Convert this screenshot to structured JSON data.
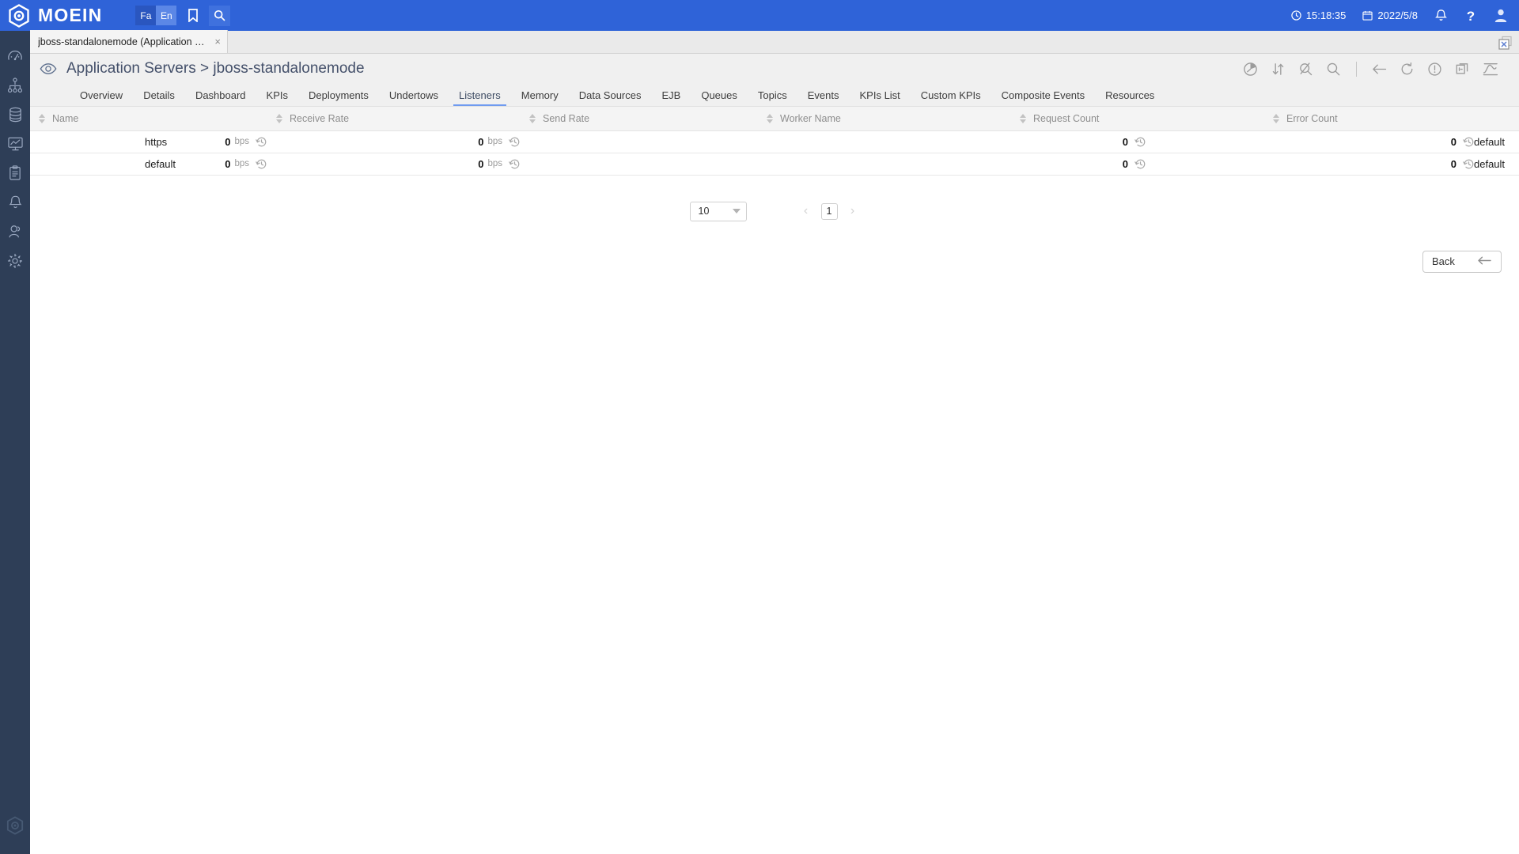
{
  "header": {
    "brand": "MOEIN",
    "logo_icon": "hexagon-eye-logo",
    "lang_fa": "Fa",
    "lang_en": "En",
    "bookmark_icon": "bookmark-icon",
    "search_icon": "search-icon",
    "time": "15:18:35",
    "date": "2022/5/8",
    "clock_icon": "clock-icon",
    "calendar_icon": "calendar-icon",
    "bell_icon": "bell-icon",
    "help_icon": "question-mark-icon",
    "user_icon": "user-avatar-icon",
    "accent_color": "#2f63d8"
  },
  "sidebar": {
    "background": "#2e3e57",
    "items": [
      {
        "icon": "gauge-icon",
        "name": "dashboard"
      },
      {
        "icon": "topology-icon",
        "name": "topology"
      },
      {
        "icon": "database-icon",
        "name": "database"
      },
      {
        "icon": "monitor-chart-icon",
        "name": "monitoring"
      },
      {
        "icon": "clipboard-icon",
        "name": "reports"
      },
      {
        "icon": "bell-icon",
        "name": "alerts"
      },
      {
        "icon": "user-icon",
        "name": "users"
      },
      {
        "icon": "gear-icon",
        "name": "settings"
      }
    ],
    "footer_icon": "moein-watermark-logo"
  },
  "tabstrip": {
    "tabs": [
      {
        "label": "jboss-standalonemode (Application S...",
        "close": "×",
        "active": true
      }
    ],
    "close_all_icon": "close-all-tabs-icon"
  },
  "breadcrumb": {
    "eye_icon": "eye-icon",
    "text": "Application Servers > jboss-standalonemode",
    "tools": [
      {
        "icon": "pie-clock-icon",
        "name": "time-range"
      },
      {
        "icon": "sort-arrows-icon",
        "name": "sort"
      },
      {
        "icon": "no-search-icon",
        "name": "clear-filter"
      },
      {
        "icon": "search-icon",
        "name": "search"
      },
      {
        "icon": "separator",
        "name": "divider"
      },
      {
        "icon": "arrow-left-icon",
        "name": "back"
      },
      {
        "icon": "refresh-icon",
        "name": "refresh"
      },
      {
        "icon": "alert-circle-icon",
        "name": "alerts"
      },
      {
        "icon": "duplicate-icon",
        "name": "duplicate"
      },
      {
        "icon": "chart-line-icon",
        "name": "chart"
      }
    ]
  },
  "navtabs": [
    {
      "label": "Overview",
      "active": false
    },
    {
      "label": "Details",
      "active": false
    },
    {
      "label": "Dashboard",
      "active": false
    },
    {
      "label": "KPIs",
      "active": false
    },
    {
      "label": "Deployments",
      "active": false
    },
    {
      "label": "Undertows",
      "active": false
    },
    {
      "label": "Listeners",
      "active": true
    },
    {
      "label": "Memory",
      "active": false
    },
    {
      "label": "Data Sources",
      "active": false
    },
    {
      "label": "EJB",
      "active": false
    },
    {
      "label": "Queues",
      "active": false
    },
    {
      "label": "Topics",
      "active": false
    },
    {
      "label": "Events",
      "active": false
    },
    {
      "label": "KPIs List",
      "active": false
    },
    {
      "label": "Custom KPIs",
      "active": false
    },
    {
      "label": "Composite Events",
      "active": false
    },
    {
      "label": "Resources",
      "active": false
    }
  ],
  "table": {
    "columns": [
      {
        "label": "Name",
        "sortable": true
      },
      {
        "label": "Receive Rate",
        "sortable": true
      },
      {
        "label": "Send Rate",
        "sortable": true
      },
      {
        "label": "Worker Name",
        "sortable": true
      },
      {
        "label": "Request Count",
        "sortable": true
      },
      {
        "label": "Error Count",
        "sortable": true
      }
    ],
    "history_icon": "history-clock-icon",
    "rows": [
      {
        "name": "https",
        "receive_rate": "0",
        "receive_unit": "bps",
        "send_rate": "0",
        "send_unit": "bps",
        "worker_name": "default",
        "request_count": "0",
        "error_count": "0"
      },
      {
        "name": "default",
        "receive_rate": "0",
        "receive_unit": "bps",
        "send_rate": "0",
        "send_unit": "bps",
        "worker_name": "default",
        "request_count": "0",
        "error_count": "0"
      }
    ]
  },
  "pagination": {
    "page_size": "10",
    "prev_arrow": "‹",
    "next_arrow": "›",
    "current_page": "1"
  },
  "footer": {
    "back_label": "Back",
    "back_icon": "arrow-left-icon"
  }
}
